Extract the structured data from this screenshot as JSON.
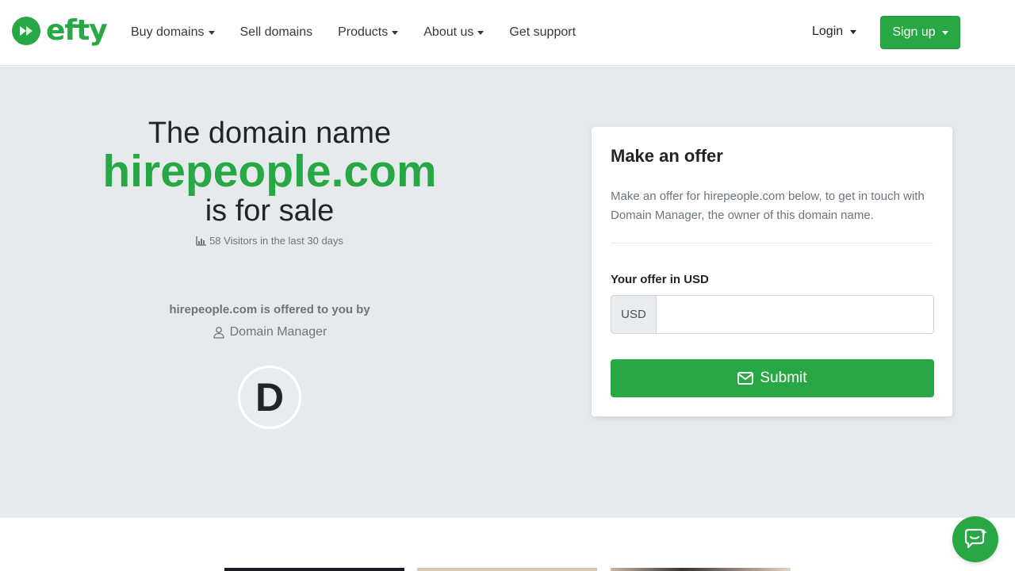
{
  "brand": {
    "name": "efty",
    "color": "#28a745"
  },
  "nav": {
    "items": [
      {
        "label": "Buy domains",
        "dropdown": true
      },
      {
        "label": "Sell domains",
        "dropdown": false
      },
      {
        "label": "Products",
        "dropdown": true
      },
      {
        "label": "About us",
        "dropdown": true
      },
      {
        "label": "Get support",
        "dropdown": false
      }
    ],
    "login_label": "Login",
    "signup_label": "Sign up"
  },
  "hero": {
    "line1": "The domain name",
    "domain": "hirepeople.com",
    "line3": "is for sale",
    "visitors_text": "58 Visitors in the last 30 days",
    "offered_by_text": "hirepeople.com is offered to you by",
    "owner_name": "Domain Manager",
    "avatar_letter": "D"
  },
  "offer_card": {
    "title": "Make an offer",
    "description": "Make an offer for hirepeople.com below, to get in touch with Domain Manager, the owner of this domain name.",
    "offer_label": "Your offer in USD",
    "currency_prefix": "USD",
    "input_value": "",
    "submit_label": "Submit"
  },
  "icons": {
    "logo": "efty-logo-icon",
    "visitors": "bar-chart-icon",
    "owner": "user-icon",
    "submit": "envelope-icon",
    "chat": "chat-support-icon"
  }
}
